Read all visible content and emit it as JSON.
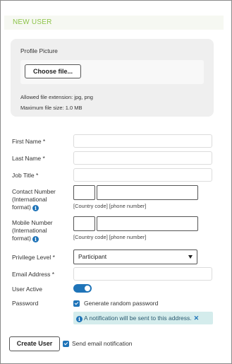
{
  "header": {
    "title": "NEW USER"
  },
  "profile_picture": {
    "label": "Profile Picture",
    "choose_button": "Choose file...",
    "allowed_extensions": "Allowed file extension: jpg, png",
    "max_size": "Maximum file size: 1.0 MB"
  },
  "fields": {
    "first_name": {
      "label": "First Name *",
      "value": ""
    },
    "last_name": {
      "label": "Last Name *",
      "value": ""
    },
    "job_title": {
      "label": "Job Title *",
      "value": ""
    },
    "contact_number": {
      "label_line1": "Contact Number",
      "label_line2": "(International",
      "label_line3": "format)",
      "country_code": "",
      "phone": "",
      "hint": "[Country code] [phone number]"
    },
    "mobile_number": {
      "label_line1": "Mobile Number",
      "label_line2": "(International",
      "label_line3": "format)",
      "country_code": "",
      "phone": "",
      "hint": "[Country code] [phone number]"
    },
    "privilege_level": {
      "label": "Privilege Level *",
      "value": "Participant"
    },
    "email": {
      "label": "Email Address *",
      "value": ""
    },
    "user_active": {
      "label": "User Active",
      "on": true
    },
    "password": {
      "label": "Password",
      "generate_random_label": "Generate random password",
      "generate_random_checked": true,
      "notice": "A notification will be sent to this address."
    }
  },
  "footer": {
    "create_button": "Create User",
    "send_email_label": "Send email notification",
    "send_email_checked": true
  },
  "colors": {
    "accent_green": "#8ec44a",
    "primary_blue": "#1f74b8",
    "notice_bg": "#d4ecec"
  },
  "icons": {
    "info": "info-icon",
    "close": "close-icon",
    "dropdown": "chevron-down-icon",
    "check": "check-icon"
  }
}
